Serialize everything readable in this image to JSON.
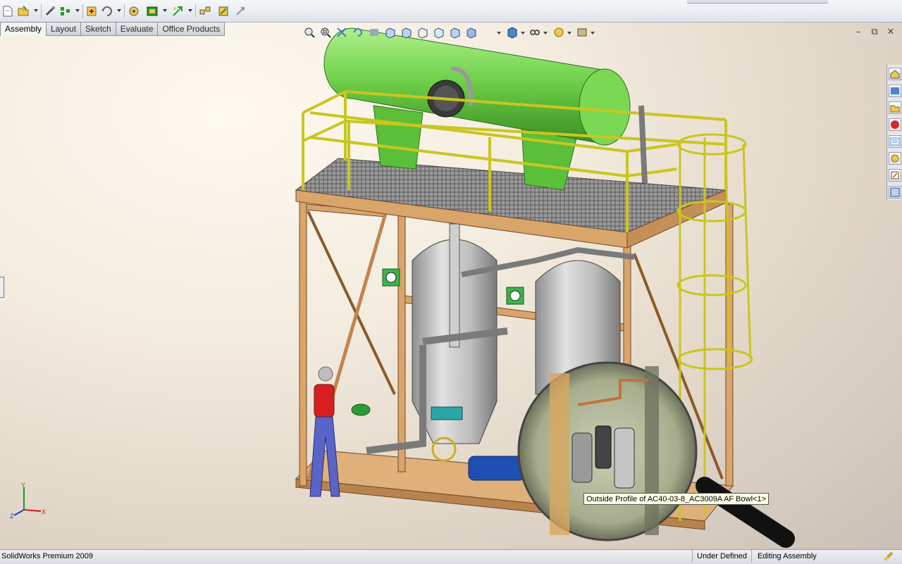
{
  "app": {
    "name": "SolidWorks Premium 2009"
  },
  "toolbar": {
    "icons": [
      "new-document-icon",
      "open-document-icon",
      "options-icon",
      "measure-icon",
      "mate-icon",
      "insert-component-icon",
      "smart-fasteners-icon",
      "move-component-icon",
      "assembly-features-icon",
      "explode-view-icon",
      "hole-series-icon",
      "interference-detection-icon",
      "instant3d-icon"
    ]
  },
  "tabs": [
    {
      "label": "Assembly",
      "active": true
    },
    {
      "label": "Layout",
      "active": false
    },
    {
      "label": "Sketch",
      "active": false
    },
    {
      "label": "Evaluate",
      "active": false
    },
    {
      "label": "Office Products",
      "active": false
    }
  ],
  "view_toolbar": {
    "icons": [
      "zoom-to-fit-icon",
      "zoom-to-area-icon",
      "previous-view-icon",
      "rotate-view-icon",
      "section-view-icon",
      "view-orientation-icon",
      "display-style-icon",
      "hide-show-icon",
      "edit-appearance-icon",
      "apply-scene-icon",
      "view-settings-icon"
    ]
  },
  "window_controls": {
    "minimize": "–",
    "restore": "⧉",
    "close": "✕"
  },
  "task_pane": {
    "icons": [
      "solidworks-resources-icon",
      "design-library-icon",
      "file-explorer-icon",
      "search-icon",
      "view-palette-icon",
      "appearances-icon",
      "custom-properties-icon",
      "document-recovery-icon"
    ]
  },
  "tooltip": {
    "text": "Outside Profile of AC40-03-8_AC3009A AF Bowl<1>"
  },
  "triad": {
    "x": "X",
    "y": "Y",
    "z": "Z"
  },
  "status": {
    "product": "SolidWorks Premium 2009",
    "definition": "Under Defined",
    "mode": "Editing Assembly"
  },
  "colors": {
    "tank": "#6fd04a",
    "railing": "#e3e32a",
    "frame": "#d9a56b",
    "vessel": "#bdbdbd",
    "pump": "#1f4fb0"
  }
}
